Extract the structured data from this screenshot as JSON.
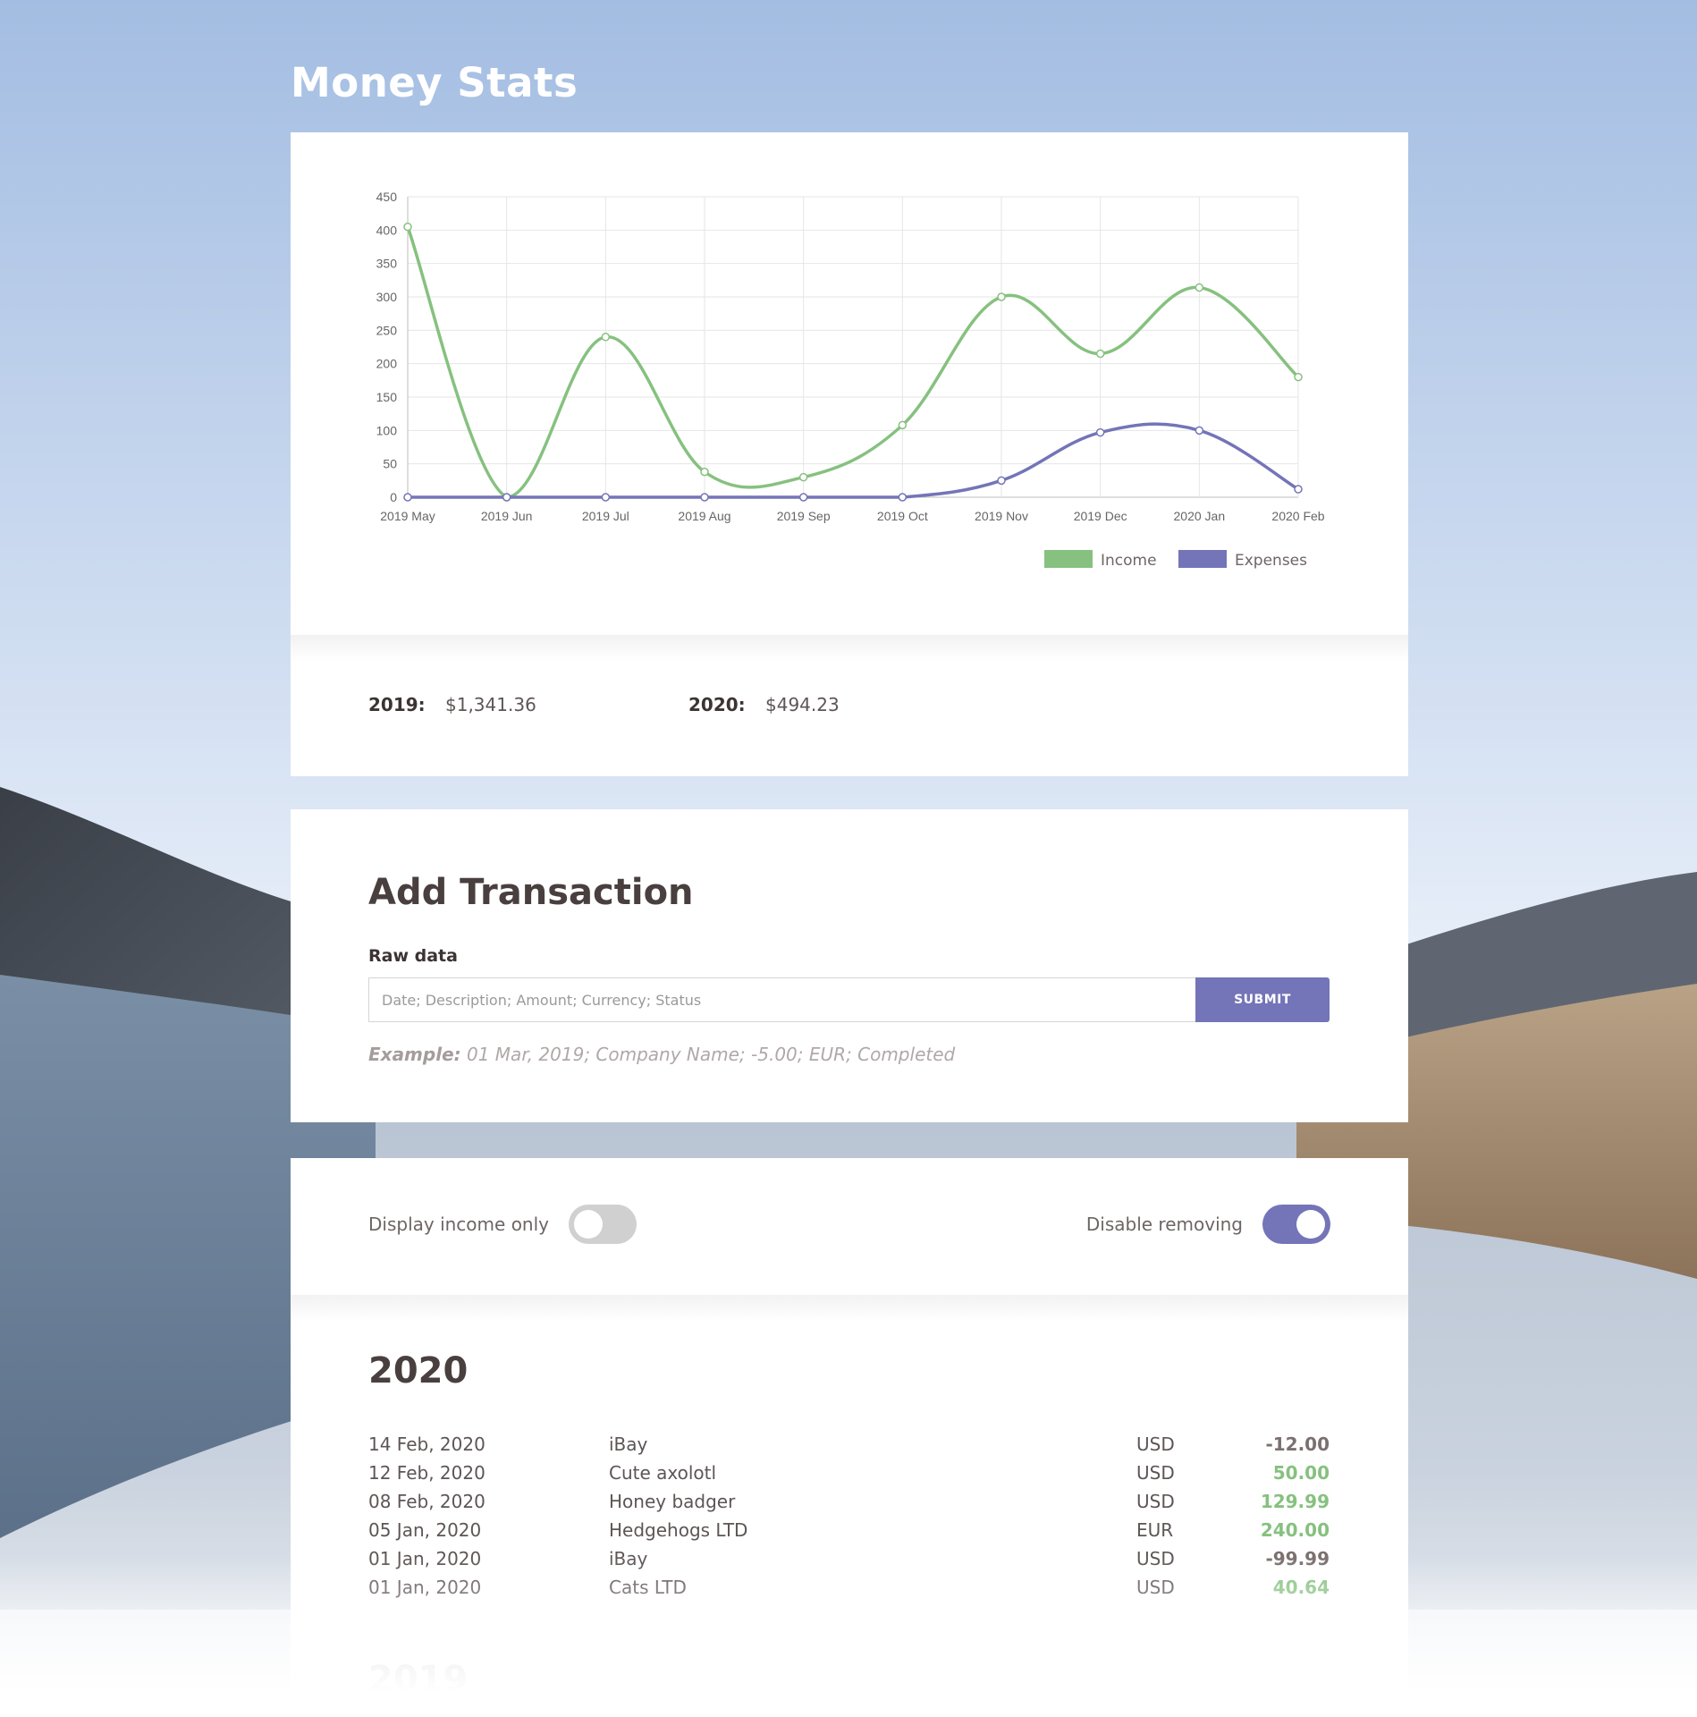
{
  "page": {
    "title": "Money Stats"
  },
  "colors": {
    "income": "#86c17f",
    "expenses": "#7474b8",
    "accent": "#7474b8",
    "positive": "#86c17f"
  },
  "chart_data": {
    "type": "line",
    "categories": [
      "2019 May",
      "2019 Jun",
      "2019 Jul",
      "2019 Aug",
      "2019 Sep",
      "2019 Oct",
      "2019 Nov",
      "2019 Dec",
      "2020 Jan",
      "2020 Feb"
    ],
    "series": [
      {
        "name": "Income",
        "color": "#86c17f",
        "values": [
          405,
          0,
          240,
          38,
          30,
          108,
          300,
          215,
          314,
          180
        ]
      },
      {
        "name": "Expenses",
        "color": "#7474b8",
        "values": [
          0,
          0,
          0,
          0,
          0,
          0,
          25,
          97,
          100,
          12
        ]
      }
    ],
    "ylim": [
      0,
      450
    ],
    "yticks": [
      0,
      50,
      100,
      150,
      200,
      250,
      300,
      350,
      400,
      450
    ],
    "title": "",
    "xlabel": "",
    "ylabel": "",
    "grid": true,
    "legend": "bottom-right",
    "smooth": true
  },
  "totals": [
    {
      "year": "2019:",
      "value": "$1,341.36"
    },
    {
      "year": "2020:",
      "value": "$494.23"
    }
  ],
  "add_transaction": {
    "title": "Add Transaction",
    "raw_label": "Raw data",
    "placeholder": "Date; Description; Amount; Currency; Status",
    "value": "",
    "submit_label": "SUBMIT",
    "example_label": "Example:",
    "example_text": " 01 Mar, 2019; Company Name; -5.00; EUR; Completed"
  },
  "filters": {
    "income_only": {
      "label": "Display income only",
      "on": false
    },
    "disable_removing": {
      "label": "Disable removing",
      "on": true
    }
  },
  "transactions": {
    "year": "2020",
    "rows": [
      {
        "date": "14 Feb, 2020",
        "description": "iBay",
        "currency": "USD",
        "amount": "-12.00"
      },
      {
        "date": "12 Feb, 2020",
        "description": "Cute axolotl",
        "currency": "USD",
        "amount": "50.00"
      },
      {
        "date": "08 Feb, 2020",
        "description": "Honey badger",
        "currency": "USD",
        "amount": "129.99"
      },
      {
        "date": "05 Jan, 2020",
        "description": "Hedgehogs LTD",
        "currency": "EUR",
        "amount": "240.00"
      },
      {
        "date": "01 Jan, 2020",
        "description": "iBay",
        "currency": "USD",
        "amount": "-99.99"
      },
      {
        "date": "01 Jan, 2020",
        "description": "Cats LTD",
        "currency": "USD",
        "amount": "40.64"
      }
    ],
    "next_year": "2019"
  }
}
